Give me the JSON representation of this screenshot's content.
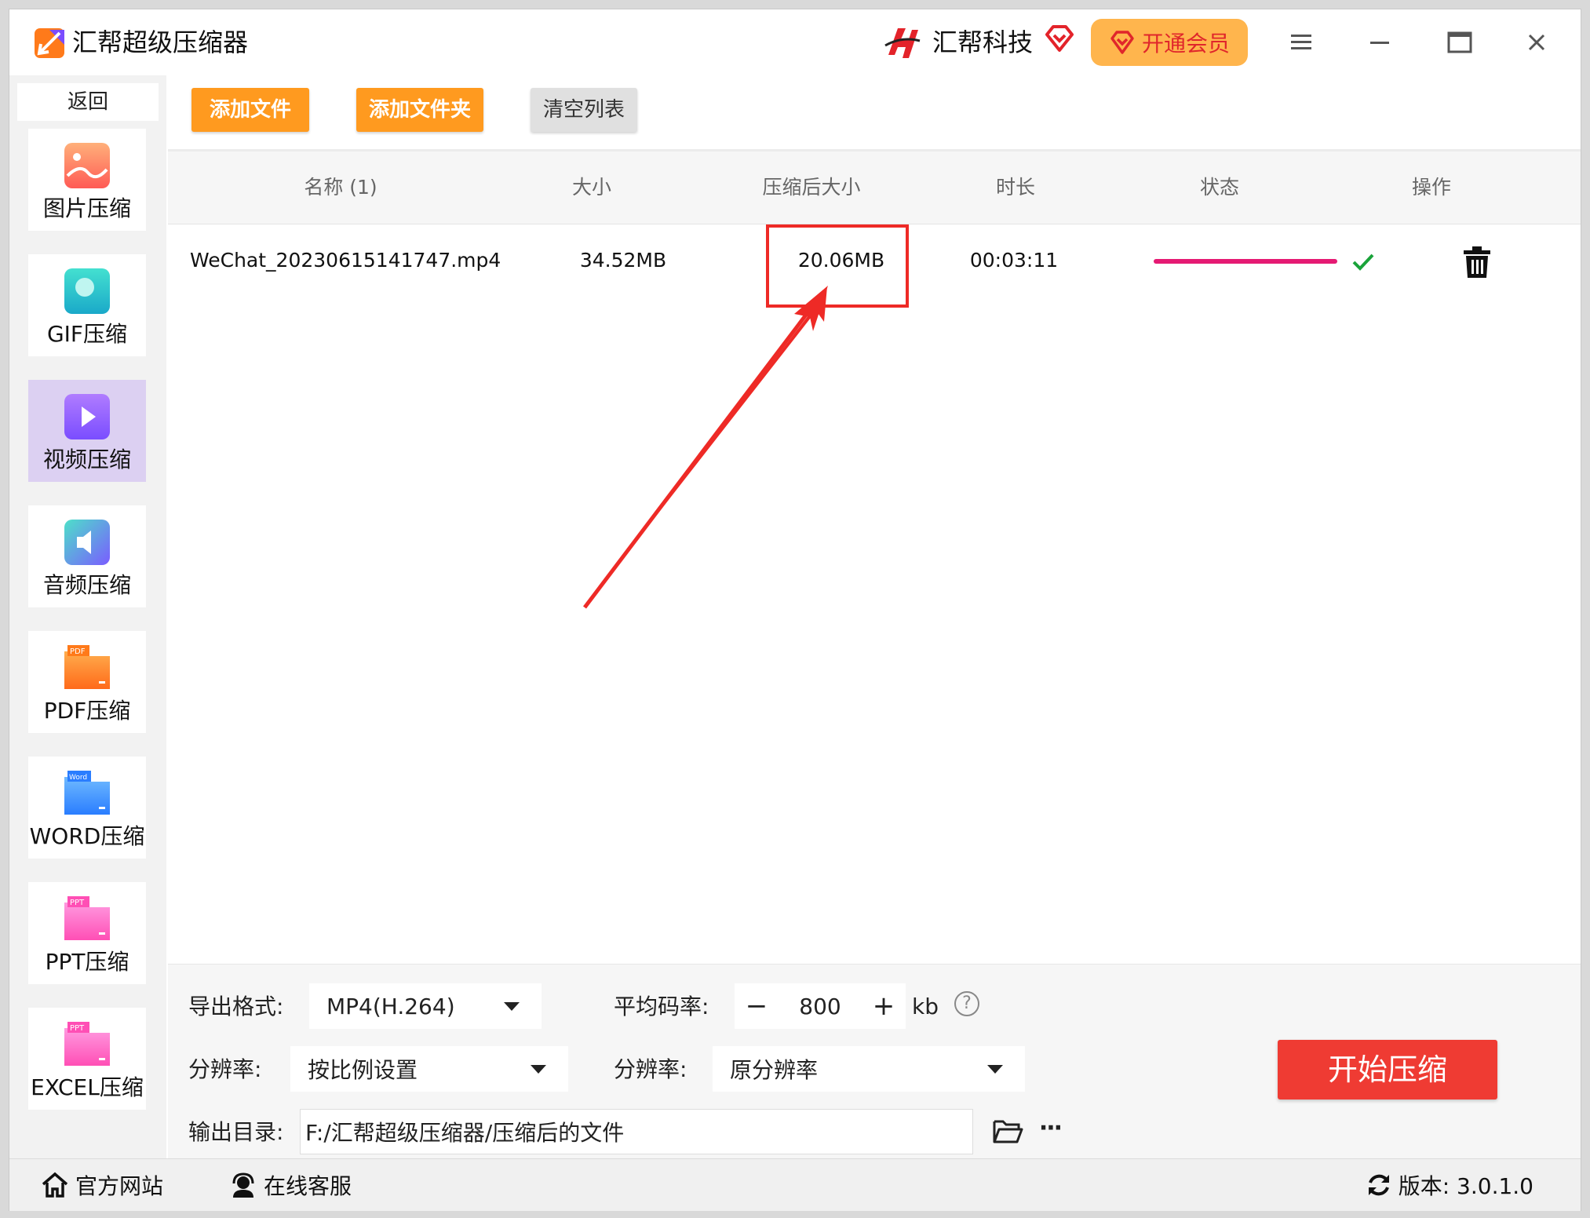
{
  "titlebar": {
    "app_title": "汇帮超级压缩器",
    "brand_name": "汇帮科技",
    "vip_label": "开通会员"
  },
  "sidebar": {
    "back_label": "返回",
    "items": [
      {
        "label": "图片压缩",
        "icon": "image-icon"
      },
      {
        "label": "GIF压缩",
        "icon": "gif-icon"
      },
      {
        "label": "视频压缩",
        "icon": "video-icon",
        "active": true
      },
      {
        "label": "音频压缩",
        "icon": "audio-icon"
      },
      {
        "label": "PDF压缩",
        "icon": "pdf-icon"
      },
      {
        "label": "WORD压缩",
        "icon": "word-icon"
      },
      {
        "label": "PPT压缩",
        "icon": "ppt-icon"
      },
      {
        "label": "EXCEL压缩",
        "icon": "excel-icon"
      }
    ]
  },
  "toolbar": {
    "add_file": "添加文件",
    "add_folder": "添加文件夹",
    "clear_list": "清空列表"
  },
  "table": {
    "columns": [
      "名称 (1)",
      "大小",
      "压缩后大小",
      "时长",
      "状态",
      "操作"
    ],
    "rows": [
      {
        "name": "WeChat_20230615141747.mp4",
        "size": "34.52MB",
        "compressed_size": "20.06MB",
        "duration": "00:03:11",
        "progress": 1.0,
        "status": "done"
      }
    ]
  },
  "settings": {
    "export_format_label": "导出格式:",
    "export_format_value": "MP4(H.264)",
    "avg_bitrate_label": "平均码率:",
    "bitrate_minus": "−",
    "bitrate_value": "800",
    "bitrate_plus": "+",
    "bitrate_unit": "kb",
    "help": "?",
    "resolution_label": "分辨率:",
    "resolution_mode": "按比例设置",
    "resolution2_label": "分辨率:",
    "resolution2_value": "原分辨率",
    "output_dir_label": "输出目录:",
    "output_dir_value": "F:/汇帮超级压缩器/压缩后的文件",
    "more": "···",
    "start_button": "开始压缩"
  },
  "statusbar": {
    "website": "官方网站",
    "support": "在线客服",
    "version": "版本:  3.0.1.0"
  },
  "colors": {
    "accent_orange": "#ff9a1f",
    "start_red": "#ef3b33",
    "progress_pink": "#e51a73",
    "highlight_red": "#ee2a26",
    "active_nav": "#dcd0f2"
  }
}
